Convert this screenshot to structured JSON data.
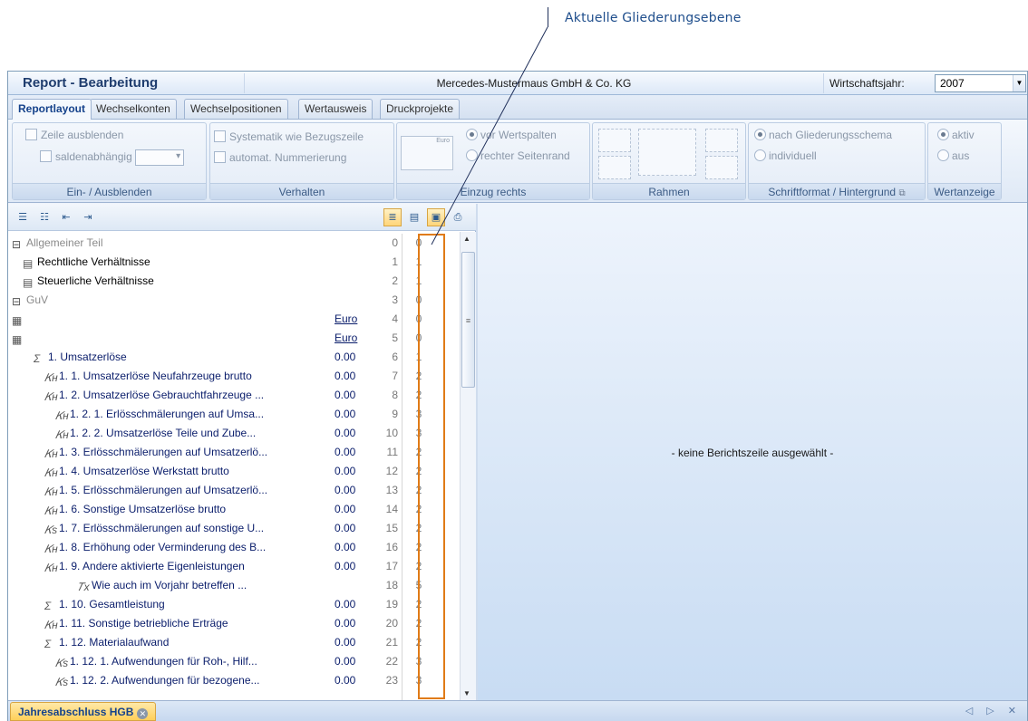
{
  "callout": "Aktuelle Gliederungsebene",
  "titlebar": {
    "title": "Report - Bearbeitung",
    "company": "Mercedes-Mustermaus GmbH & Co. KG",
    "fiscal_label": "Wirtschaftsjahr:",
    "fiscal_year": "2007"
  },
  "tabs": [
    "Reportlayout",
    "Wechselkonten",
    "Wechselpositionen",
    "Wertausweis",
    "Druckprojekte"
  ],
  "ribbon": {
    "ein_aus": {
      "label": "Ein- / Ausblenden",
      "hide_row": "Zeile ausblenden",
      "balance_dep": "saldenabhängig"
    },
    "verhalten": {
      "label": "Verhalten",
      "systematik": "Systematik wie Bezugszeile",
      "numbering": "automat. Nummerierung"
    },
    "einzug": {
      "label": "Einzug rechts",
      "before_cols": "vor Wertspalten",
      "right_margin": "rechter Seitenrand",
      "icon_text": "Euro"
    },
    "rahmen": {
      "label": "Rahmen"
    },
    "schrift": {
      "label": "Schriftformat / Hintergrund",
      "schema": "nach Gliederungsschema",
      "individual": "individuell"
    },
    "wert": {
      "label": "Wertanzeige",
      "active": "aktiv",
      "off": "aus"
    }
  },
  "tree_rows": [
    {
      "label": "Allgemeiner Teil",
      "value": "",
      "num": "0",
      "level": "0",
      "icon": "⊟",
      "style": "grey",
      "indent": 0
    },
    {
      "label": "Rechtliche Verhältnisse",
      "value": "",
      "num": "1",
      "level": "1",
      "icon": "🗎",
      "style": "blk",
      "indent": 1
    },
    {
      "label": "Steuerliche Verhältnisse",
      "value": "",
      "num": "2",
      "level": "1",
      "icon": "🗎",
      "style": "blk",
      "indent": 1
    },
    {
      "label": "GuV",
      "value": "",
      "num": "3",
      "level": "0",
      "icon": "⊟",
      "style": "grey",
      "indent": 0
    },
    {
      "label": "",
      "value": "Euro",
      "num": "4",
      "level": "0",
      "icon": "Euro",
      "style": "",
      "indent": 0,
      "link": true
    },
    {
      "label": "",
      "value": "Euro",
      "num": "5",
      "level": "0",
      "icon": "Euro",
      "style": "",
      "indent": 0,
      "link": true
    },
    {
      "label": "1.  Umsatzerlöse",
      "value": "0.00",
      "num": "6",
      "level": "1",
      "icon": "Σ",
      "indent": 2
    },
    {
      "label": "1. 1.  Umsatzerlöse Neufahrzeuge brutto",
      "value": "0.00",
      "num": "7",
      "level": "2",
      "icon": "KH",
      "indent": 3
    },
    {
      "label": "1. 2.  Umsatzerlöse Gebrauchtfahrzeuge ...",
      "value": "0.00",
      "num": "8",
      "level": "2",
      "icon": "KH",
      "indent": 3
    },
    {
      "label": "1. 2. 1.  Erlösschmälerungen auf Umsa...",
      "value": "0.00",
      "num": "9",
      "level": "3",
      "icon": "KH",
      "indent": 4
    },
    {
      "label": "1. 2. 2.  Umsatzerlöse Teile und Zube...",
      "value": "0.00",
      "num": "10",
      "level": "3",
      "icon": "KH",
      "indent": 4
    },
    {
      "label": "1. 3.  Erlösschmälerungen auf Umsatzerlö...",
      "value": "0.00",
      "num": "11",
      "level": "2",
      "icon": "KH",
      "indent": 3
    },
    {
      "label": "1. 4.  Umsatzerlöse Werkstatt brutto",
      "value": "0.00",
      "num": "12",
      "level": "2",
      "icon": "KH",
      "indent": 3
    },
    {
      "label": "1. 5.  Erlösschmälerungen auf Umsatzerlö...",
      "value": "0.00",
      "num": "13",
      "level": "2",
      "icon": "KH",
      "indent": 3
    },
    {
      "label": "1. 6.  Sonstige Umsatzerlöse brutto",
      "value": "0.00",
      "num": "14",
      "level": "2",
      "icon": "KH",
      "indent": 3
    },
    {
      "label": "1. 7.  Erlösschmälerungen auf sonstige U...",
      "value": "0.00",
      "num": "15",
      "level": "2",
      "icon": "KS",
      "indent": 3
    },
    {
      "label": "1. 8.  Erhöhung oder Verminderung des B...",
      "value": "0.00",
      "num": "16",
      "level": "2",
      "icon": "KH",
      "indent": 3
    },
    {
      "label": "1. 9.  Andere aktivierte Eigenleistungen",
      "value": "0.00",
      "num": "17",
      "level": "2",
      "icon": "KH",
      "indent": 3
    },
    {
      "label": "Wie auch im Vorjahr betreffen ...",
      "value": "",
      "num": "18",
      "level": "5",
      "icon": "Tx",
      "indent": 6
    },
    {
      "label": "1. 10.  Gesamtleistung",
      "value": "0.00",
      "num": "19",
      "level": "2",
      "icon": "Σ",
      "indent": 3
    },
    {
      "label": "1. 11.  Sonstige betriebliche Erträge",
      "value": "0.00",
      "num": "20",
      "level": "2",
      "icon": "KH",
      "indent": 3
    },
    {
      "label": "1. 12.  Materialaufwand",
      "value": "0.00",
      "num": "21",
      "level": "2",
      "icon": "Σ",
      "indent": 3
    },
    {
      "label": "1. 12. 1.  Aufwendungen für Roh-, Hilf...",
      "value": "0.00",
      "num": "22",
      "level": "3",
      "icon": "KS",
      "indent": 4
    },
    {
      "label": "1. 12. 2.  Aufwendungen für bezogene...",
      "value": "0.00",
      "num": "23",
      "level": "3",
      "icon": "KS",
      "indent": 4
    }
  ],
  "right_pane": {
    "message": "- keine Berichtszeile ausgewählt -"
  },
  "statusbar": {
    "doc_tab": "Jahresabschluss HGB",
    "nav": "◁ ▷ ✕"
  },
  "colors": {
    "accent": "#15428b",
    "highlight_box": "#e07b17",
    "row_text": "#0a1d6b"
  }
}
